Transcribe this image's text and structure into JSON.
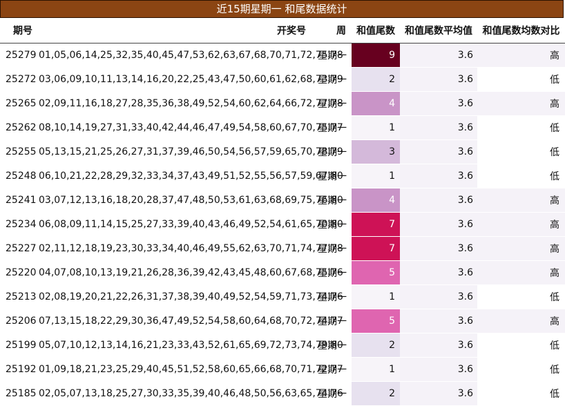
{
  "title": "近15期星期一 和尾数据统计",
  "headers": {
    "issue": "期号",
    "numbers": "开奖号",
    "week": "周",
    "sum_tail": "和值尾数",
    "avg": "和值尾数平均值",
    "compare": "和值尾数均数对比"
  },
  "colors": {
    "title_bg": "#8b4513",
    "sum_scale": {
      "1": "#f7f4f9",
      "2": "#e7e1ef",
      "3": "#d4b9da",
      "4": "#c994c7",
      "5": "#df65b0",
      "7": "#ce1256",
      "9": "#67001f"
    }
  },
  "rows": [
    {
      "issue": "25279",
      "numbers": "01,05,06,14,25,32,35,40,45,47,53,62,63,67,68,70,71,72,75,78",
      "week": "星期一",
      "sum_tail": "9",
      "avg": "3.6",
      "compare": "高"
    },
    {
      "issue": "25272",
      "numbers": "03,06,09,10,11,13,14,16,20,22,25,43,47,50,60,61,62,68,73,79",
      "week": "星期一",
      "sum_tail": "2",
      "avg": "3.6",
      "compare": "低"
    },
    {
      "issue": "25265",
      "numbers": "02,09,11,16,18,27,28,35,36,38,49,52,54,60,62,64,66,72,77,78",
      "week": "星期一",
      "sum_tail": "4",
      "avg": "3.6",
      "compare": "高"
    },
    {
      "issue": "25262",
      "numbers": "08,10,14,19,27,31,33,40,42,44,46,47,49,54,58,60,67,70,75,77",
      "week": "星期一",
      "sum_tail": "1",
      "avg": "3.6",
      "compare": "低"
    },
    {
      "issue": "25255",
      "numbers": "05,13,15,21,25,26,27,31,37,39,46,50,54,56,57,59,65,70,78,79",
      "week": "星期一",
      "sum_tail": "3",
      "avg": "3.6",
      "compare": "低"
    },
    {
      "issue": "25248",
      "numbers": "06,10,21,22,28,29,32,33,34,37,43,49,51,52,55,56,57,59,67,80",
      "week": "星期一",
      "sum_tail": "1",
      "avg": "3.6",
      "compare": "低"
    },
    {
      "issue": "25241",
      "numbers": "03,07,12,13,16,18,20,28,37,47,48,50,53,61,63,68,69,75,76,80",
      "week": "星期一",
      "sum_tail": "4",
      "avg": "3.6",
      "compare": "高"
    },
    {
      "issue": "25234",
      "numbers": "06,08,09,11,14,15,25,27,33,39,40,43,46,49,52,54,61,65,70,80",
      "week": "星期一",
      "sum_tail": "7",
      "avg": "3.6",
      "compare": "高"
    },
    {
      "issue": "25227",
      "numbers": "02,11,12,18,19,23,30,33,34,40,46,49,55,62,63,70,71,74,77,78",
      "week": "星期一",
      "sum_tail": "7",
      "avg": "3.6",
      "compare": "高"
    },
    {
      "issue": "25220",
      "numbers": "04,07,08,10,13,19,21,26,28,36,39,42,43,45,48,60,67,68,75,76",
      "week": "星期一",
      "sum_tail": "5",
      "avg": "3.6",
      "compare": "高"
    },
    {
      "issue": "25213",
      "numbers": "02,08,19,20,21,22,26,31,37,38,39,40,49,52,54,59,71,73,74,76",
      "week": "星期一",
      "sum_tail": "1",
      "avg": "3.6",
      "compare": "低"
    },
    {
      "issue": "25206",
      "numbers": "07,13,15,18,22,29,30,36,47,49,52,54,58,60,64,68,70,72,74,77",
      "week": "星期一",
      "sum_tail": "5",
      "avg": "3.6",
      "compare": "高"
    },
    {
      "issue": "25199",
      "numbers": "05,07,10,12,13,14,16,21,23,33,43,52,61,65,69,72,73,74,79,80",
      "week": "星期一",
      "sum_tail": "2",
      "avg": "3.6",
      "compare": "低"
    },
    {
      "issue": "25192",
      "numbers": "01,09,18,21,23,25,29,40,45,51,52,58,60,65,66,68,70,71,72,77",
      "week": "星期一",
      "sum_tail": "1",
      "avg": "3.6",
      "compare": "低"
    },
    {
      "issue": "25185",
      "numbers": "02,05,07,13,18,25,27,30,33,35,39,40,46,48,50,56,63,65,74,76",
      "week": "星期一",
      "sum_tail": "2",
      "avg": "3.6",
      "compare": "低"
    }
  ]
}
